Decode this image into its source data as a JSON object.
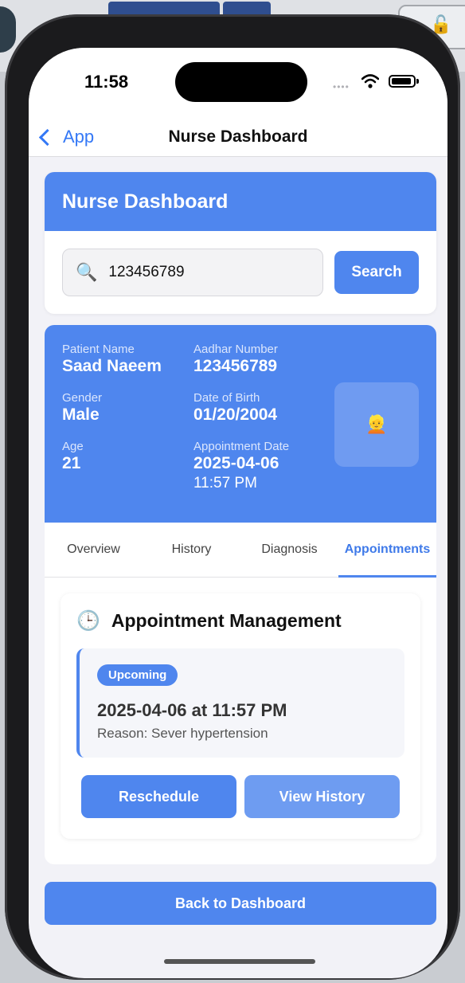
{
  "status_bar": {
    "time": "11:58"
  },
  "nav": {
    "back_label": "App",
    "title": "Nurse Dashboard"
  },
  "dashboard": {
    "header_title": "Nurse Dashboard",
    "search": {
      "value": "123456789",
      "icon": "magnifying-glass",
      "button_label": "Search"
    }
  },
  "patient": {
    "name_label": "Patient Name",
    "name": "Saad Naeem",
    "aadhar_label": "Aadhar Number",
    "aadhar": "123456789",
    "gender_label": "Gender",
    "gender": "Male",
    "dob_label": "Date of Birth",
    "dob": "01/20/2004",
    "age_label": "Age",
    "age": "21",
    "appt_date_label": "Appointment Date",
    "appt_date": "2025-04-06",
    "appt_time": "11:57 PM",
    "avatar": "👱"
  },
  "tabs": [
    {
      "label": "Overview",
      "active": false
    },
    {
      "label": "History",
      "active": false
    },
    {
      "label": "Diagnosis",
      "active": false
    },
    {
      "label": "Appointments",
      "active": true
    }
  ],
  "appointments": {
    "title": "Appointment Management",
    "icon": "🕒",
    "item": {
      "status": "Upcoming",
      "datetime": "2025-04-06 at 11:57 PM",
      "reason": "Reason: Sever hypertension"
    },
    "reschedule_label": "Reschedule",
    "view_history_label": "View History"
  },
  "footer": {
    "back_to_dashboard_label": "Back to Dashboard"
  },
  "colors": {
    "primary": "#4f86ee",
    "secondary": "#6e9cf1",
    "ios_link": "#3478f6"
  }
}
